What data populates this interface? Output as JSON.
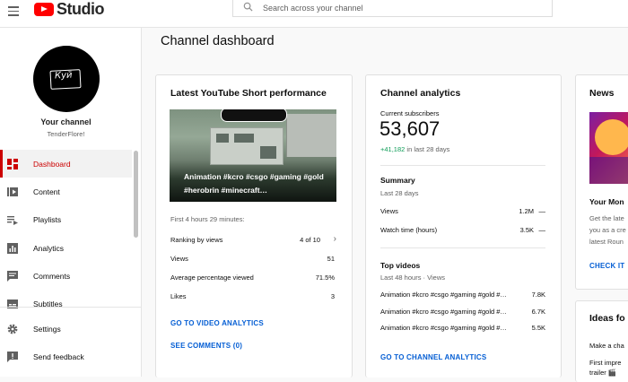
{
  "header": {
    "logo_text": "Studio",
    "search_placeholder": "Search across your channel"
  },
  "sidebar": {
    "channel_title": "Your channel",
    "channel_name": "TenderFlore!",
    "avatar_text": "Куй",
    "items": [
      {
        "label": "Dashboard",
        "icon": "dashboard-icon",
        "active": true
      },
      {
        "label": "Content",
        "icon": "content-icon"
      },
      {
        "label": "Playlists",
        "icon": "playlists-icon"
      },
      {
        "label": "Analytics",
        "icon": "analytics-icon"
      },
      {
        "label": "Comments",
        "icon": "comments-icon"
      },
      {
        "label": "Subtitles",
        "icon": "subtitles-icon"
      },
      {
        "label": "Settings",
        "icon": "settings-icon"
      },
      {
        "label": "Send feedback",
        "icon": "feedback-icon"
      }
    ]
  },
  "page_title": "Channel dashboard",
  "short_card": {
    "title": "Latest YouTube Short performance",
    "thumb_text": "Animation #kcro #csgo #gaming #gold #herobrin #minecraft…",
    "period": "First 4 hours 29 minutes:",
    "rows": [
      {
        "label": "Ranking by views",
        "value": "4 of 10"
      },
      {
        "label": "Views",
        "value": "51"
      },
      {
        "label": "Average percentage viewed",
        "value": "71.5%"
      },
      {
        "label": "Likes",
        "value": "3"
      }
    ],
    "link1": "GO TO VIDEO ANALYTICS",
    "link2": "SEE COMMENTS (0)"
  },
  "analytics_card": {
    "title": "Channel analytics",
    "subs_label": "Current subscribers",
    "subs_value": "53,607",
    "subs_delta": "+41,182",
    "subs_delta_suffix": "in last 28 days",
    "summary_title": "Summary",
    "summary_period": "Last 28 days",
    "summary_rows": [
      {
        "label": "Views",
        "value": "1.2M",
        "trend": "—"
      },
      {
        "label": "Watch time (hours)",
        "value": "3.5K",
        "trend": "—"
      }
    ],
    "top_title": "Top videos",
    "top_period": "Last 48 hours · Views",
    "top_rows": [
      {
        "label": "Animation #kcro #csgo #gaming #gold #…",
        "value": "7.8K"
      },
      {
        "label": "Animation #kcro #csgo #gaming #gold #…",
        "value": "6.7K"
      },
      {
        "label": "Animation #kcro #csgo #gaming #gold #…",
        "value": "5.5K"
      }
    ],
    "link": "GO TO CHANNEL ANALYTICS"
  },
  "news_card": {
    "title": "News",
    "item_title": "Your Mon",
    "item_text": [
      "Get the late",
      "you as a cre",
      "latest Roun"
    ],
    "link": "CHECK IT"
  },
  "ideas_card": {
    "title": "Ideas fo",
    "line1": "Make a cha",
    "line2": "First impre",
    "line3": "trailer 🎬"
  },
  "colors": {
    "accent_red": "#cc0000",
    "link_blue": "#065fd4",
    "positive_green": "#0f9d58"
  }
}
